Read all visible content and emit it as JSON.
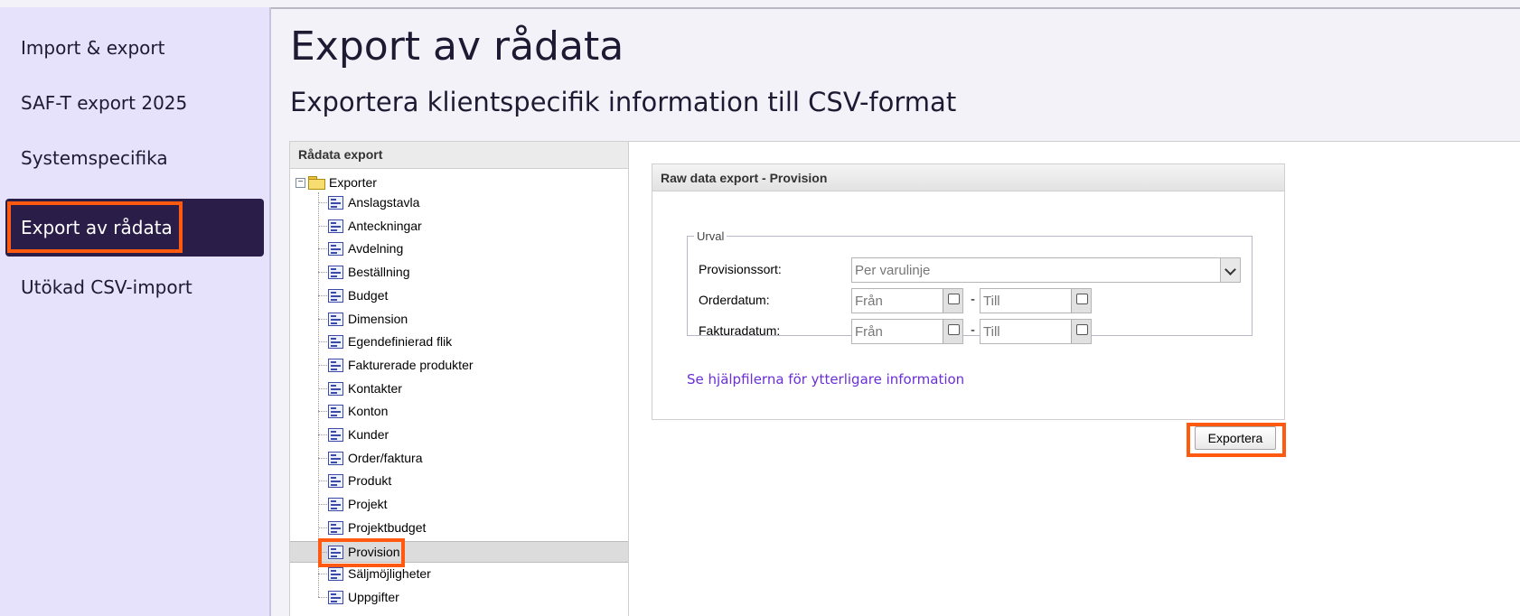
{
  "sidebar": {
    "items": [
      {
        "label": "Import & export"
      },
      {
        "label": "SAF-T export 2025"
      },
      {
        "label": "Systemspecifika"
      },
      {
        "label": "Export av rådata",
        "active": true
      },
      {
        "label": "Utökad CSV-import"
      }
    ]
  },
  "page": {
    "title": "Export av rådata",
    "subtitle": "Exportera klientspecifik information till CSV-format"
  },
  "tree": {
    "header": "Rådata export",
    "root_label": "Exporter",
    "items": [
      "Anslagstavla",
      "Anteckningar",
      "Avdelning",
      "Beställning",
      "Budget",
      "Dimension",
      "Egendefinierad flik",
      "Fakturerade produkter",
      "Kontakter",
      "Konton",
      "Kunder",
      "Order/faktura",
      "Produkt",
      "Projekt",
      "Projektbudget",
      "Provision",
      "Säljmöjligheter",
      "Uppgifter"
    ],
    "selected": "Provision"
  },
  "export_panel": {
    "header": "Raw data export - Provision",
    "fieldset_legend": "Urval",
    "provisionssort_label": "Provisionssort:",
    "provisionssort_value": "Per varulinje",
    "orderdatum_label": "Orderdatum:",
    "fakturadatum_label": "Fakturadatum:",
    "from_placeholder": "Från",
    "to_placeholder": "Till",
    "separator": "-",
    "help_link": "Se hjälpfilerna för ytterligare information",
    "export_button": "Exportera"
  },
  "colors": {
    "sidebar_bg": "#e7e2fb",
    "sidebar_active": "#2a1d47",
    "highlight": "#ff5a10",
    "link": "#6b2fd6"
  }
}
